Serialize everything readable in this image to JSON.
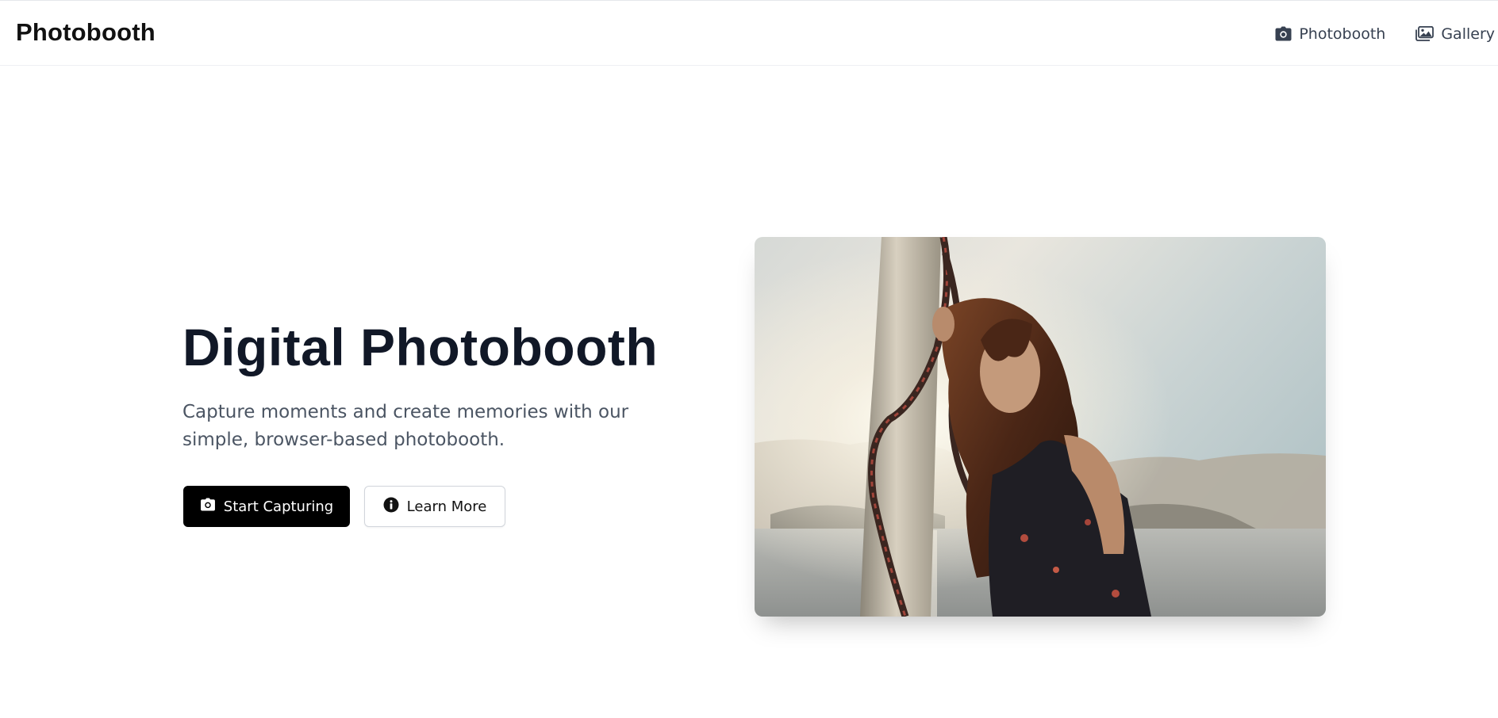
{
  "header": {
    "brand": "Photobooth",
    "nav": [
      {
        "label": "Photobooth",
        "icon": "camera-icon"
      },
      {
        "label": "Gallery",
        "icon": "images-icon"
      }
    ]
  },
  "hero": {
    "title": "Digital Photobooth",
    "subtitle": "Capture moments and create memories with our simple, browser-based photobooth.",
    "primary_button": {
      "label": "Start Capturing",
      "icon": "camera-icon"
    },
    "secondary_button": {
      "label": "Learn More",
      "icon": "info-circle-icon"
    },
    "image": {
      "alt": "Woman leaning against a mast by the sea"
    }
  },
  "colors": {
    "primary": "#000000",
    "text": "#111827",
    "muted": "#4b5563",
    "border": "#d1d5db"
  }
}
